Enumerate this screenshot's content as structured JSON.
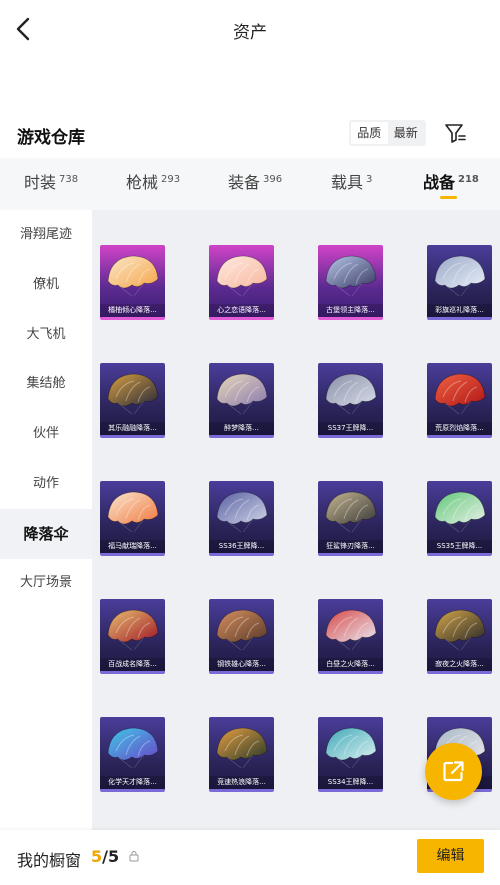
{
  "header": {
    "title": "资产",
    "back_icon": "chevron-left-icon"
  },
  "warehouse": {
    "title": "游戏仓库",
    "sort_options": [
      "品质",
      "最新"
    ],
    "filter_icon": "filter-icon"
  },
  "tabs": [
    {
      "label": "时装",
      "count": "738"
    },
    {
      "label": "枪械",
      "count": "293"
    },
    {
      "label": "装备",
      "count": "396"
    },
    {
      "label": "载具",
      "count": "3"
    },
    {
      "label": "战备",
      "count": "218",
      "active": true
    }
  ],
  "sidebar": [
    {
      "label": "滑翔尾迹"
    },
    {
      "label": "僚机"
    },
    {
      "label": "大飞机"
    },
    {
      "label": "集结舱"
    },
    {
      "label": "伙伴"
    },
    {
      "label": "动作"
    },
    {
      "label": "降落伞",
      "active": true
    },
    {
      "label": "大厅场景"
    }
  ],
  "items": [
    {
      "name": "橘柚倾心降落...",
      "rarity": "pink",
      "colors": [
        "#f5a64a",
        "#fbe6c8"
      ]
    },
    {
      "name": "心之恋语降落...",
      "rarity": "pink",
      "colors": [
        "#f8b8a0",
        "#ffe9e0"
      ]
    },
    {
      "name": "古堡领主降落...",
      "rarity": "pink",
      "colors": [
        "#3a3a66",
        "#b8c8e8"
      ]
    },
    {
      "name": "彩旗巡礼降落...",
      "rarity": "blue",
      "colors": [
        "#e8eef8",
        "#9aa8c8"
      ]
    },
    {
      "name": "其乐融融降落...",
      "rarity": "blue",
      "colors": [
        "#2a2a3a",
        "#d8a040"
      ]
    },
    {
      "name": "醉梦降落...",
      "rarity": "blue",
      "colors": [
        "#8a7ab0",
        "#e8d8b8"
      ]
    },
    {
      "name": "SS37王牌降...",
      "rarity": "blue",
      "colors": [
        "#d8dce8",
        "#8890a8"
      ]
    },
    {
      "name": "荒原烈焰降落...",
      "rarity": "blue",
      "colors": [
        "#b01818",
        "#f06040"
      ]
    },
    {
      "name": "福马献瑞降落...",
      "rarity": "blue",
      "colors": [
        "#f07840",
        "#fbe8d0"
      ]
    },
    {
      "name": "SS36王牌降...",
      "rarity": "blue",
      "colors": [
        "#d0d4e8",
        "#5860a0"
      ]
    },
    {
      "name": "狂鲨锋刃降落...",
      "rarity": "blue",
      "colors": [
        "#3a3a3a",
        "#c8b890"
      ]
    },
    {
      "name": "SS35王牌降...",
      "rarity": "blue",
      "colors": [
        "#e8f0e8",
        "#60c878"
      ]
    },
    {
      "name": "百战成名降落...",
      "rarity": "blue",
      "colors": [
        "#a01828",
        "#e8c070"
      ]
    },
    {
      "name": "钢铁雄心降落...",
      "rarity": "blue",
      "colors": [
        "#5a3a2a",
        "#d89060"
      ]
    },
    {
      "name": "白昼之火降落...",
      "rarity": "blue",
      "colors": [
        "#e8e8f0",
        "#d84848"
      ]
    },
    {
      "name": "寂夜之火降落...",
      "rarity": "blue",
      "colors": [
        "#2a2a2a",
        "#d8a848"
      ]
    },
    {
      "name": "化学天才降落...",
      "rarity": "blue",
      "colors": [
        "#6848c8",
        "#40c8e8"
      ]
    },
    {
      "name": "竞速热浪降落...",
      "rarity": "blue",
      "colors": [
        "#2a3a2a",
        "#e8a040"
      ]
    },
    {
      "name": "SS34王牌降...",
      "rarity": "blue",
      "colors": [
        "#d8f0f0",
        "#40a8b8"
      ]
    },
    {
      "name": "",
      "rarity": "blue",
      "colors": [
        "#e8e8e8",
        "#a8b8c8"
      ]
    }
  ],
  "share_icon": "share-external-icon",
  "bottom": {
    "label": "我的橱窗",
    "current": "5",
    "separator": "/",
    "total": "5",
    "info_icon": "lock-icon",
    "edit_label": "编辑"
  },
  "colors": {
    "accent": "#f7b500",
    "accent_text": "#f0a500"
  }
}
